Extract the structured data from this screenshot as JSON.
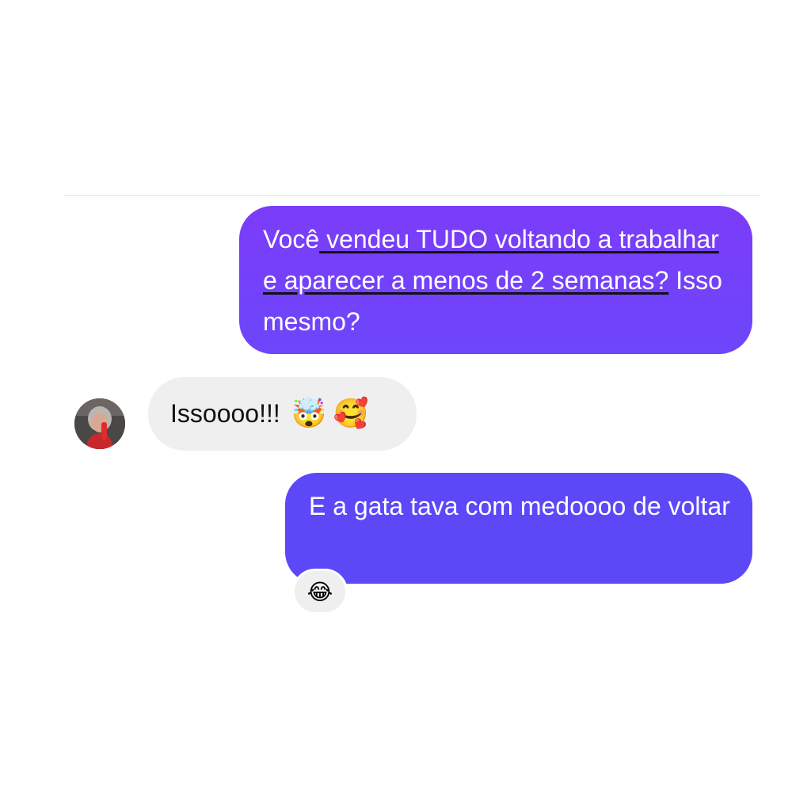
{
  "messages": [
    {
      "direction": "outgoing",
      "segments": [
        {
          "text": "Você",
          "underline": false
        },
        {
          "text": " vendeu TUDO voltando a trabalhar e aparecer a menos de 2 semanas?",
          "underline": true
        },
        {
          "text": " Isso mesmo?",
          "underline": false
        }
      ],
      "bubble_color": "#7b3cf9"
    },
    {
      "direction": "incoming",
      "text": "Issoooo!!!",
      "emojis": [
        "🤯",
        "🥰"
      ],
      "avatar_icon": "user-avatar-photo",
      "bubble_color": "#efefef"
    },
    {
      "direction": "outgoing",
      "text": "E a gata tava com medoooo de voltar",
      "reaction": "😂",
      "bubble_color": "#5d48f7"
    }
  ]
}
